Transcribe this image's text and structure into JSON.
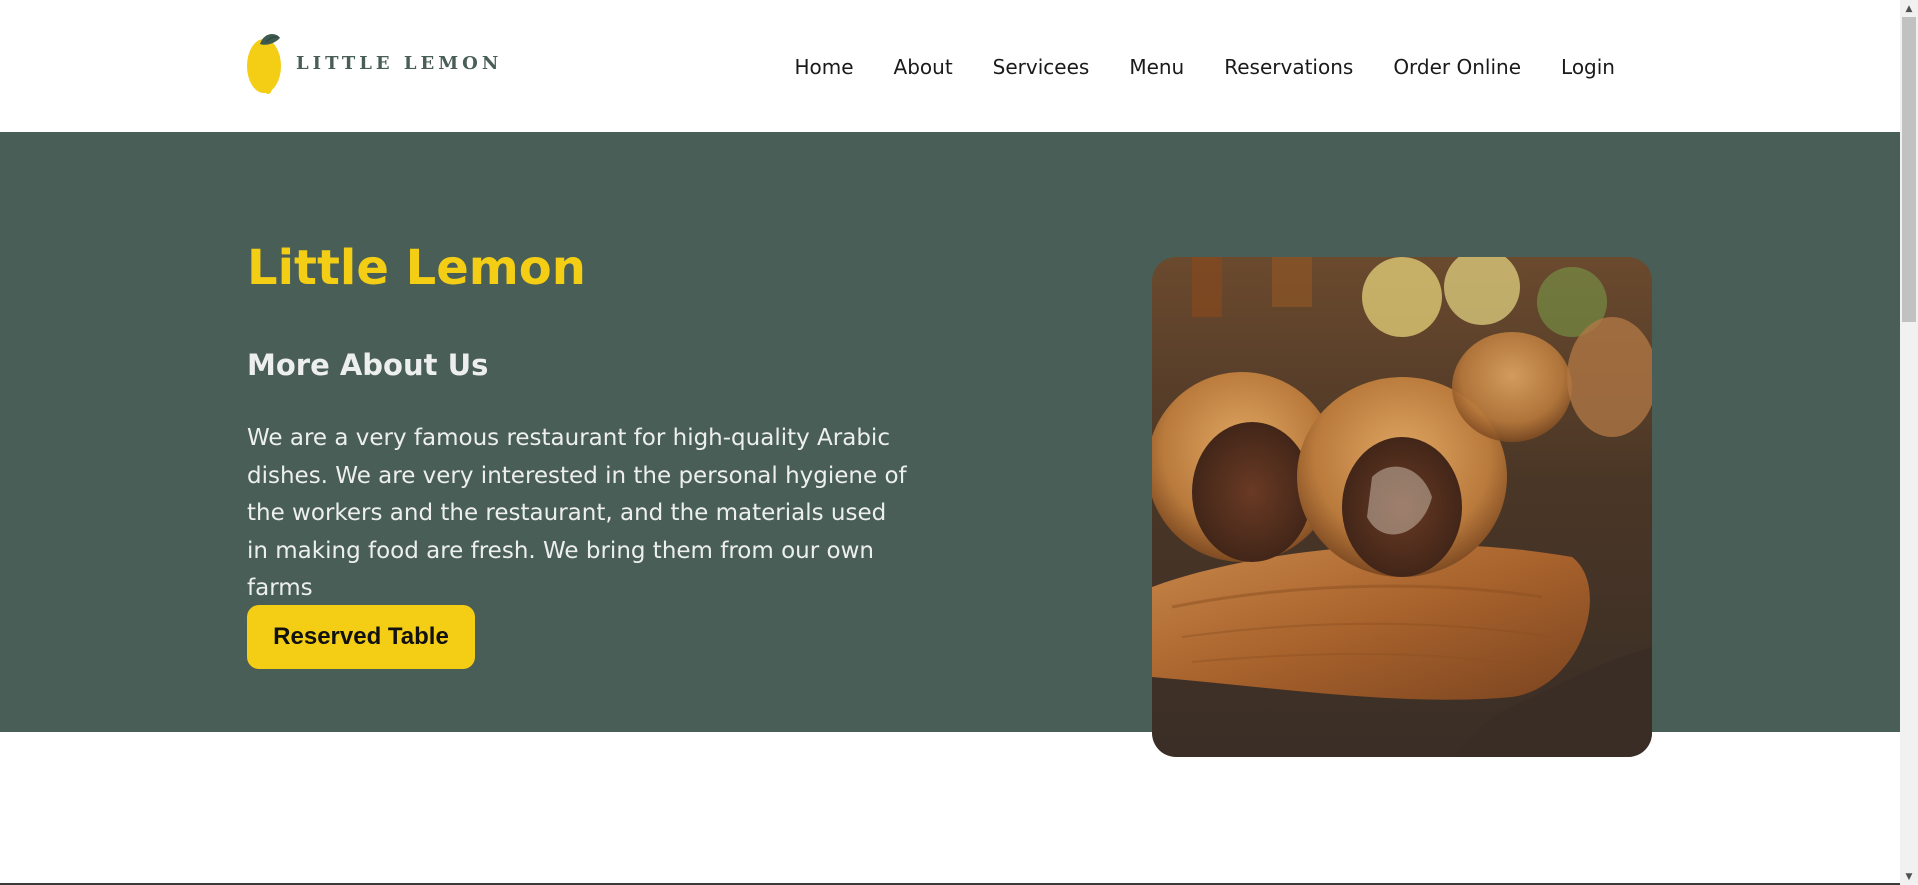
{
  "brand": {
    "logo_text": "LITTLE LEMON",
    "colors": {
      "primary": "#495e57",
      "accent": "#f4ce14",
      "light": "#edefee"
    }
  },
  "nav": {
    "items": [
      {
        "label": "Home"
      },
      {
        "label": "About"
      },
      {
        "label": "Servicees"
      },
      {
        "label": "Menu"
      },
      {
        "label": "Reservations"
      },
      {
        "label": "Order Online"
      },
      {
        "label": "Login"
      }
    ]
  },
  "hero": {
    "title": "Little Lemon",
    "subtitle": "More About Us",
    "description": "We are a very famous restaurant for high-quality Arabic dishes. We are very interested in the personal hygiene of the workers and the restaurant, and the materials used in making food are fresh. We bring them from our own farms",
    "button_label": "Reserved Table",
    "image_icon": "food-photo"
  }
}
